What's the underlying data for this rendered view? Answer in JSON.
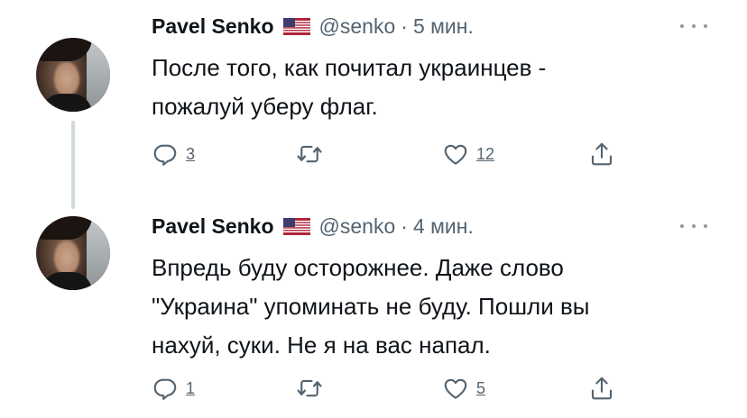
{
  "tweets": [
    {
      "author_name": "Pavel Senko",
      "author_flag": "us-flag-emoji",
      "handle": "@senko",
      "separator": "·",
      "time": "5 мин.",
      "text_lines": [
        "После того, как почитал украинцев -",
        "пожалуй уберу флаг."
      ],
      "reply_count": "3",
      "retweet_count": "",
      "like_count": "12"
    },
    {
      "author_name": "Pavel Senko",
      "author_flag": "us-flag-emoji",
      "handle": "@senko",
      "separator": "·",
      "time": "4 мин.",
      "text_lines": [
        "Впредь буду осторожнее. Даже слово",
        "\"Украина\" упоминать не буду. Пошли вы",
        "нахуй, суки. Не я на вас напал."
      ],
      "reply_count": "1",
      "retweet_count": "",
      "like_count": "5"
    }
  ],
  "icons": {
    "reply": "reply-icon",
    "retweet": "retweet-icon",
    "like": "heart-icon",
    "share": "share-icon",
    "more": "more-icon"
  },
  "colors": {
    "text": "#0f1419",
    "muted": "#536471",
    "thread_line": "#cfd9de"
  }
}
